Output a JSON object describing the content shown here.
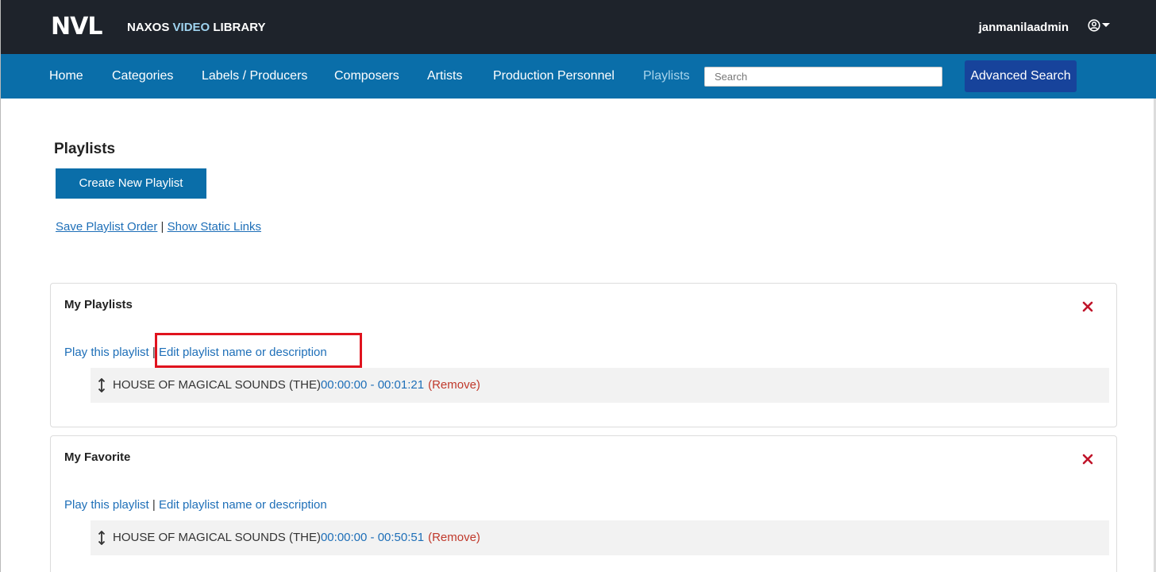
{
  "header": {
    "logo_text": "NVL",
    "brand_part1": "NAXOS ",
    "brand_highlight": "VIDEO",
    "brand_part2": " LIBRARY",
    "username": "janmanilaadmin"
  },
  "nav": {
    "items": [
      {
        "label": "Home"
      },
      {
        "label": "Categories"
      },
      {
        "label": "Labels / Producers"
      },
      {
        "label": "Composers"
      },
      {
        "label": "Artists"
      },
      {
        "label": "Production Personnel"
      },
      {
        "label": "Playlists",
        "active": true
      }
    ],
    "search_placeholder": "Search",
    "advanced_search_label": "Advanced Search"
  },
  "page": {
    "title": "Playlists",
    "create_button": "Create New Playlist",
    "save_order_link": "Save Playlist Order",
    "separator": " | ",
    "show_links_link": "Show Static Links"
  },
  "playlists": [
    {
      "name": "My Playlists",
      "play_link": "Play this playlist",
      "separator": " | ",
      "edit_link": "Edit playlist name or description",
      "tracks": [
        {
          "title": "HOUSE OF MAGICAL SOUNDS (THE)",
          "time": "00:00:00 - 00:01:21",
          "remove": "(Remove)"
        }
      ]
    },
    {
      "name": "My Favorite",
      "play_link": "Play this playlist",
      "separator": " | ",
      "edit_link": "Edit playlist name or description",
      "tracks": [
        {
          "title": "HOUSE OF MAGICAL SOUNDS (THE)",
          "time": "00:00:00 - 00:50:51",
          "remove": "(Remove)"
        }
      ]
    }
  ],
  "colors": {
    "topbar": "#1e232b",
    "navbar": "#0a6ea9",
    "advanced_button": "#17439b",
    "link": "#1e6fb8",
    "remove": "#c0392b",
    "highlight": "#e0131e"
  }
}
